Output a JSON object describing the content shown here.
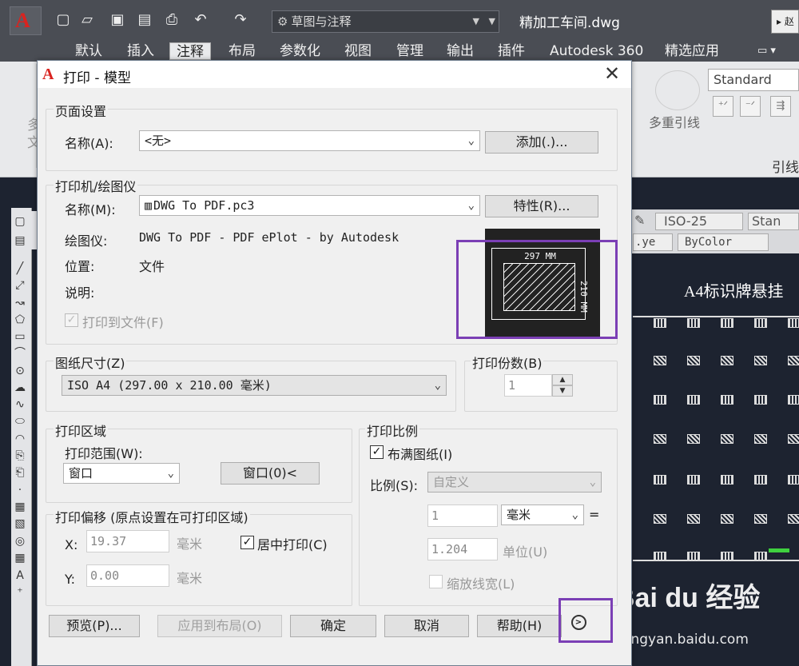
{
  "app": {
    "title_bar": {
      "workspace": "草图与注释",
      "document_title": "精加工车间.dwg",
      "search_stub": "▸ 赵"
    },
    "menu_tabs": [
      "默认",
      "插入",
      "注释",
      "布局",
      "参数化",
      "视图",
      "管理",
      "输出",
      "插件",
      "Autodesk 360",
      "精选应用"
    ],
    "active_tab": "注释",
    "ribbon": {
      "text_style": "Standard",
      "multileader_label": "多重引线",
      "panel_label": "引线",
      "left_stub_1": "多",
      "left_stub_2": "文"
    },
    "properties": {
      "dim_style": "ISO-25",
      "table_style": "Stan",
      "layer_stub": ".ye",
      "color": "ByColor"
    },
    "drawing": {
      "title": "A4标识牌悬挂"
    },
    "watermark": {
      "logo": "Bai du 经验",
      "url": "jingyan.baidu.com"
    }
  },
  "dialog": {
    "title": "打印 - 模型",
    "page_setup": {
      "group_label": "页面设置",
      "name_label": "名称(A):",
      "name_value": "<无>",
      "add_button": "添加(.)..."
    },
    "printer": {
      "group_label": "打印机/绘图仪",
      "name_label": "名称(M):",
      "name_value": "DWG To PDF.pc3",
      "properties_button": "特性(R)...",
      "plotter_label": "绘图仪:",
      "plotter_value": "DWG To PDF - PDF ePlot - by Autodesk",
      "location_label": "位置:",
      "location_value": "文件",
      "description_label": "说明:",
      "print_to_file_label": "打印到文件(F)",
      "print_to_file_checked": true,
      "preview_width": "297 MM",
      "preview_height": "210 MM"
    },
    "paper_size": {
      "group_label": "图纸尺寸(Z)",
      "value": "ISO A4 (297.00 x 210.00 毫米)"
    },
    "copies": {
      "group_label": "打印份数(B)",
      "value": "1"
    },
    "plot_area": {
      "group_label": "打印区域",
      "range_label": "打印范围(W):",
      "range_value": "窗口",
      "window_button": "窗口(0)<"
    },
    "plot_offset": {
      "group_label": "打印偏移 (原点设置在可打印区域)",
      "x_label": "X:",
      "x_value": "19.37",
      "x_unit": "毫米",
      "y_label": "Y:",
      "y_value": "0.00",
      "y_unit": "毫米",
      "center_label": "居中打印(C)",
      "center_checked": true
    },
    "plot_scale": {
      "group_label": "打印比例",
      "fit_label": "布满图纸(I)",
      "fit_checked": true,
      "scale_label": "比例(S):",
      "scale_value": "自定义",
      "value1": "1",
      "unit1": "毫米",
      "equals": "=",
      "value2": "1.204",
      "unit2": "单位(U)",
      "lineweight_label": "缩放线宽(L)"
    },
    "buttons": {
      "preview": "预览(P)...",
      "apply_layout": "应用到布局(O)",
      "ok": "确定",
      "cancel": "取消",
      "help": "帮助(H)"
    }
  },
  "colors": {
    "highlight": "#7b3fb5",
    "autocad_red": "#d9231f",
    "canvas": "#1d2330"
  },
  "icons": {
    "more_options": "chevron-right-circle-icon"
  }
}
